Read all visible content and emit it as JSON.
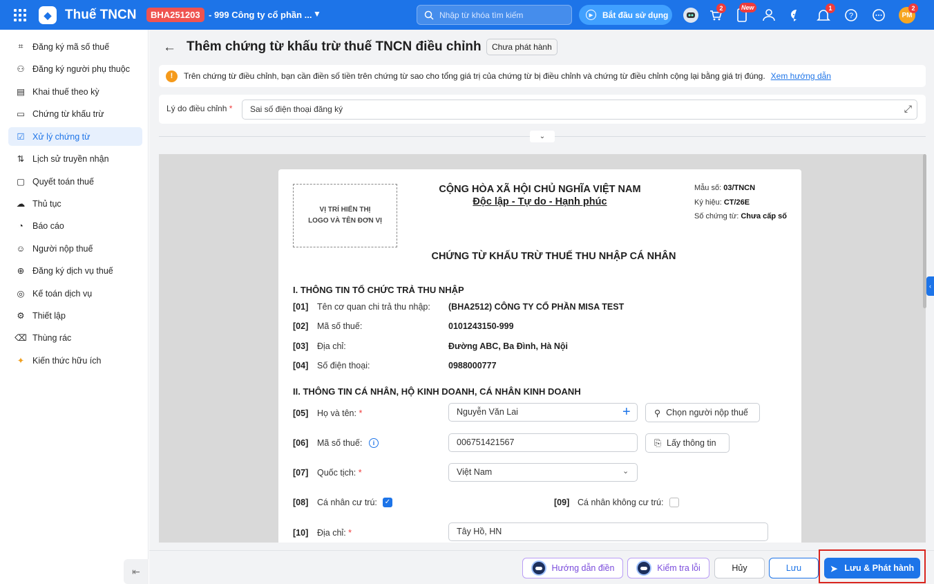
{
  "header": {
    "app_title": "Thuế TNCN",
    "org_code": "BHA251203",
    "org_name": "- 999 Công ty cổ phần ...",
    "search_placeholder": "Nhập từ khóa tìm kiếm",
    "start_label": "Bắt đầu sử dụng",
    "cart_badge": "2",
    "new_badge": "New",
    "bell_badge": "1",
    "avatar_initials": "PM",
    "avatar_badge": "2"
  },
  "sidebar": {
    "items": [
      {
        "label": "Đăng ký mã số thuế",
        "icon": "id-scan-icon"
      },
      {
        "label": "Đăng ký người phụ thuộc",
        "icon": "people-icon"
      },
      {
        "label": "Khai thuế theo kỳ",
        "icon": "document-icon"
      },
      {
        "label": "Chứng từ khấu trừ",
        "icon": "receipt-icon"
      },
      {
        "label": "Xử lý chứng từ",
        "icon": "document-check-icon"
      },
      {
        "label": "Lịch sử truyền nhận",
        "icon": "transfer-icon"
      },
      {
        "label": "Quyết toán thuế",
        "icon": "folder-icon"
      },
      {
        "label": "Thủ tục",
        "icon": "cloud-icon"
      },
      {
        "label": "Báo cáo",
        "icon": "pie-chart-icon"
      },
      {
        "label": "Người nộp thuế",
        "icon": "user-icon"
      },
      {
        "label": "Đăng ký dịch vụ thuế",
        "icon": "document-add-icon"
      },
      {
        "label": "Kế toán dịch vụ",
        "icon": "compass-icon"
      },
      {
        "label": "Thiết lập",
        "icon": "gear-icon"
      },
      {
        "label": "Thùng rác",
        "icon": "trash-icon"
      },
      {
        "label": "Kiến thức hữu ích",
        "icon": "knowledge-icon"
      }
    ],
    "active_index": 4
  },
  "page": {
    "title": "Thêm chứng từ khấu trừ thuế TNCN điều chỉnh",
    "status": "Chưa phát hành",
    "notice": "Trên chứng từ điều chỉnh, bạn cần điền số tiền trên chứng từ sao cho tổng giá trị của chứng từ bị điều chỉnh và chứng từ điều chỉnh cộng lại bằng giá trị đúng.",
    "notice_link": "Xem hướng dẫn",
    "reason_label": "Lý do điều chỉnh",
    "reason_value": "Sai số điện thoại đăng ký"
  },
  "document": {
    "logo_placeholder": "VỊ TRÍ HIỂN THỊ\nLOGO VÀ TÊN ĐƠN VỊ",
    "nation": "CỘNG HÒA XÃ HỘI CHỦ NGHĨA VIỆT NAM",
    "motto": "Độc lập - Tự do - Hạnh phúc",
    "form_label": "Mẫu số:",
    "form_value": "03/TNCN",
    "symbol_label": "Ký hiệu:",
    "symbol_value": "CT/26E",
    "number_label": "Số chứng từ:",
    "number_value": "Chưa cấp số",
    "title": "CHỨNG TỪ KHẤU TRỪ THUẾ THU NHẬP CÁ NHÂN",
    "section1": "I. THÔNG TIN TỔ CHỨC TRẢ THU NHẬP",
    "org_rows": [
      {
        "code": "[01]",
        "label": "Tên cơ quan chi trả thu nhập:",
        "value": "(BHA2512) CÔNG TY CỔ PHẦN MISA TEST"
      },
      {
        "code": "[02]",
        "label": "Mã số thuế:",
        "value": "0101243150-999"
      },
      {
        "code": "[03]",
        "label": "Địa chỉ:",
        "value": "Đường ABC, Ba Đình, Hà Nội"
      },
      {
        "code": "[04]",
        "label": "Số điện thoại:",
        "value": "0988000777"
      }
    ],
    "section2": "II. THÔNG TIN CÁ NHÂN, HỘ KINH DOANH, CÁ NHÂN KINH DOANH",
    "f05_code": "[05]",
    "f05_label": "Họ và tên:",
    "f05_value": "Nguyễn Văn Lai",
    "choose_taxpayer": "Chọn người nộp thuế",
    "f06_code": "[06]",
    "f06_label": "Mã số thuế:",
    "f06_value": "006751421567",
    "get_info": "Lấy thông tin",
    "f07_code": "[07]",
    "f07_label": "Quốc tịch:",
    "f07_value": "Việt Nam",
    "f08_code": "[08]",
    "f08_label": "Cá nhân cư trú:",
    "f08_checked": true,
    "f09_code": "[09]",
    "f09_label": "Cá nhân không cư trú:",
    "f09_checked": false,
    "f10_code": "[10]",
    "f10_label": "Địa chỉ:",
    "f10_value": "Tây Hồ, HN"
  },
  "footer": {
    "guide": "Hướng dẫn điền",
    "check": "Kiểm tra lỗi",
    "cancel": "Hủy",
    "save": "Lưu",
    "save_publish": "Lưu & Phát hành"
  },
  "colors": {
    "primary": "#1d74e8",
    "danger": "#ef3b3b",
    "warning": "#f59a1b",
    "highlight": "#d9241c"
  }
}
